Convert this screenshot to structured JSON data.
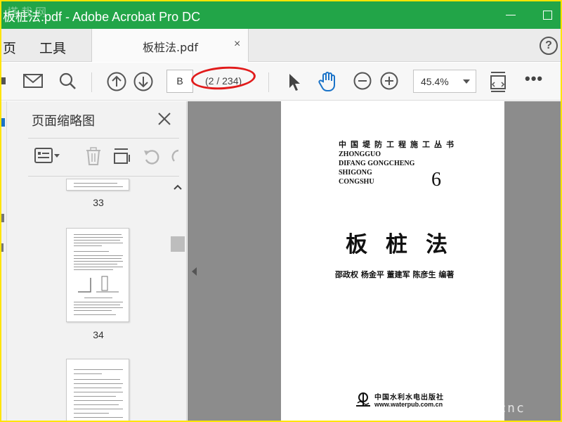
{
  "window": {
    "title": "板桩法.pdf - Adobe Acrobat Pro DC",
    "watermark": "塔栽网"
  },
  "tabs": {
    "home_label": "页",
    "tools_label": "工具",
    "document_tab_label": "板桩法.pdf",
    "close_glyph": "×",
    "help_glyph": "?"
  },
  "toolbar": {
    "page_input_value": "B",
    "page_count": "(2 / 234)",
    "zoom_value": "45.4%",
    "more_glyph": "•••",
    "highlight_color": "#e11b1b"
  },
  "thumbnail_panel": {
    "title": "页面缩略图",
    "thumbnails": [
      {
        "page_number": "33"
      },
      {
        "page_number": "34"
      },
      {
        "page_number": ""
      }
    ]
  },
  "document_page": {
    "series_title": "中国堤防工程施工丛书",
    "series_pinyin": [
      "ZHONGGUO",
      "DIFANG GONGCHENG",
      "SHIGONG",
      "CONGSHU"
    ],
    "volume_number": "6",
    "book_title": "板桩法",
    "authors": "邵政权   杨金平   董建军   陈彦生   编著",
    "publisher_name": "中国水利水电出版社",
    "publisher_url": "www.waterpub.com.cn"
  },
  "corner_watermark": "www.cnc",
  "colors": {
    "titlebar": "#22a548",
    "outer_border": "#ffe400",
    "doc_background": "#8c8c8c"
  }
}
